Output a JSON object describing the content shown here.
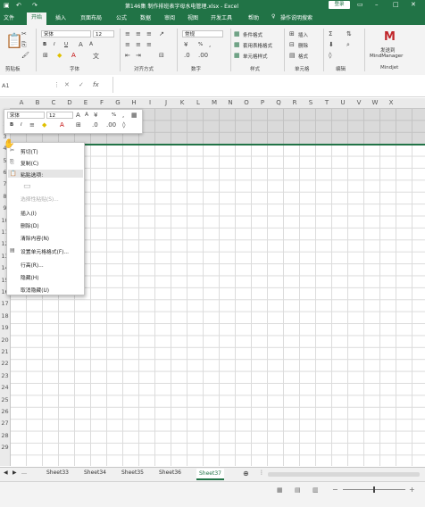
{
  "title_bar": {
    "document_title": "第146集 制作排班表字母水电管理.xlsx - Excel",
    "login_button": "登录",
    "undo_icon": "undo-icon",
    "redo_icon": "redo-icon",
    "minimize_icon": "minimize-icon",
    "maximize_icon": "maximize-icon",
    "close_icon": "close-icon"
  },
  "ribbon_tabs": [
    "文件",
    "开始",
    "插入",
    "页面布局",
    "公式",
    "数据",
    "审阅",
    "视图",
    "开发工具",
    "帮助",
    "操作说明搜索"
  ],
  "ribbon": {
    "clipboard": {
      "label": "剪贴板",
      "paste_icon": "paste-icon"
    },
    "font": {
      "label": "字体",
      "font_name": "宋体",
      "font_size": "12",
      "bold": "B",
      "italic": "I",
      "underline": "U"
    },
    "alignment": {
      "label": "对齐方式"
    },
    "number": {
      "label": "数字",
      "format": "常规",
      "percent": "%"
    },
    "styles": {
      "label": "样式",
      "conditional": "条件格式",
      "table": "套用表格格式",
      "cell": "单元格样式"
    },
    "cells": {
      "label": "单元格",
      "insert": "插入",
      "delete": "删除",
      "format": "格式"
    },
    "editing": {
      "label": "编辑"
    },
    "mindjet": {
      "label": "Mindjet",
      "send_to": "发送到",
      "product": "MindManager"
    }
  },
  "formula_bar": {
    "name_box": "A1",
    "fx": "fx",
    "value": ""
  },
  "columns": [
    "A",
    "B",
    "C",
    "D",
    "E",
    "F",
    "G",
    "H",
    "I",
    "J",
    "K",
    "L",
    "M",
    "N",
    "O",
    "P",
    "Q",
    "R",
    "S",
    "T",
    "U",
    "V",
    "W",
    "X"
  ],
  "rows": [
    "1",
    "2",
    "3",
    "4",
    "5",
    "6",
    "7",
    "8",
    "9",
    "10",
    "11",
    "12",
    "13",
    "14",
    "15",
    "16",
    "17",
    "18",
    "19",
    "20",
    "21",
    "22",
    "23",
    "24",
    "25",
    "26",
    "27",
    "28",
    "29"
  ],
  "mini_toolbar": {
    "font_name": "宋体",
    "font_size": "12",
    "percent": "%",
    "bold": "B",
    "italic": "I"
  },
  "context_menu": {
    "items": [
      {
        "label": "剪切(T)",
        "icon": "scissors-icon",
        "disabled": false
      },
      {
        "label": "复制(C)",
        "icon": "copy-icon",
        "disabled": false
      },
      {
        "label": "粘贴选项:",
        "icon": "paste-icon",
        "disabled": false
      },
      {
        "label": "",
        "icon": "clipboard-icon",
        "disabled": true
      },
      {
        "label": "选择性粘贴(S)...",
        "icon": "",
        "disabled": true
      },
      {
        "label": "插入(I)",
        "icon": "",
        "disabled": false
      },
      {
        "label": "删除(D)",
        "icon": "",
        "disabled": false
      },
      {
        "label": "清除内容(N)",
        "icon": "",
        "disabled": false
      },
      {
        "label": "设置单元格格式(F)...",
        "icon": "format-cells-icon",
        "disabled": false
      },
      {
        "label": "行高(R)...",
        "icon": "",
        "disabled": false
      },
      {
        "label": "隐藏(H)",
        "icon": "",
        "disabled": false
      },
      {
        "label": "取消隐藏(U)",
        "icon": "",
        "disabled": false
      }
    ]
  },
  "sheet_tabs": [
    "Sheet33",
    "Sheet34",
    "Sheet35",
    "Sheet36",
    "Sheet37"
  ],
  "active_sheet": "Sheet37",
  "colors": {
    "accent": "#217346",
    "ribbon_bg": "#f3f3f3"
  }
}
